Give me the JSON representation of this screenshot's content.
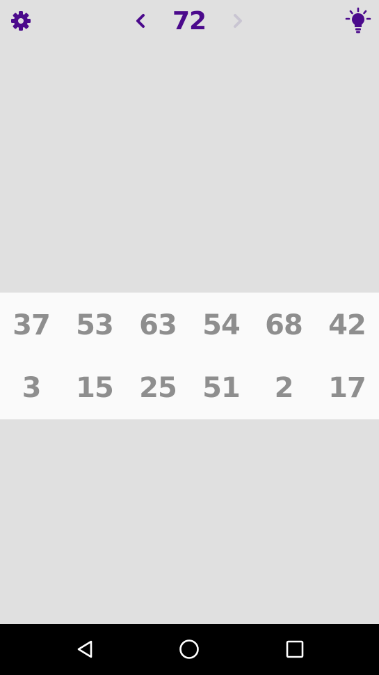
{
  "header": {
    "level": "72"
  },
  "grid": {
    "rows": [
      [
        "37",
        "53",
        "63",
        "54",
        "68",
        "42"
      ],
      [
        "3",
        "15",
        "25",
        "51",
        "2",
        "17"
      ]
    ]
  },
  "icons": {
    "settings": "gear-icon",
    "previous": "chevron-left-icon",
    "next": "chevron-right-icon",
    "hint": "lightbulb-icon",
    "nav_back": "triangle-back-icon",
    "nav_home": "circle-home-icon",
    "nav_recents": "square-recents-icon"
  },
  "colors": {
    "background": "#e0e0e0",
    "panel": "#fafafa",
    "accent": "#4b0a8c",
    "number": "#8e8e8e",
    "disabled": "#c9c5d2",
    "nav_bar": "#000000",
    "nav_icon": "#ffffff"
  }
}
